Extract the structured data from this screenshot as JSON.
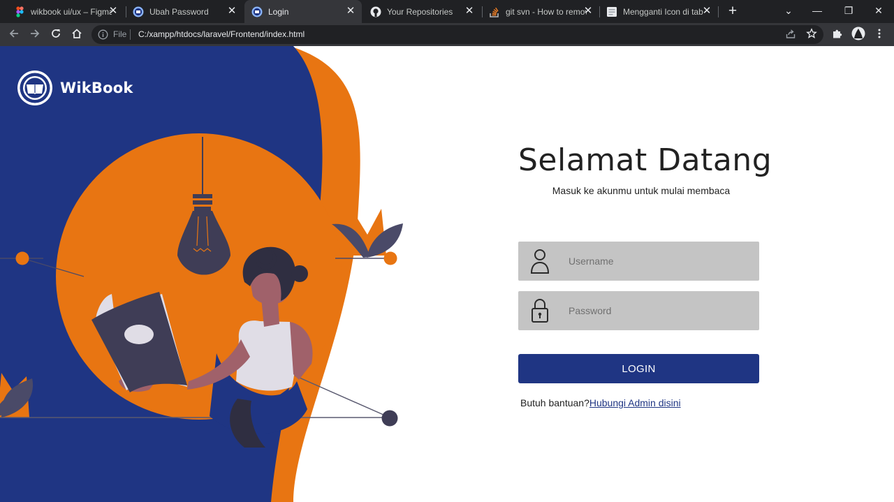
{
  "browser": {
    "tabs": [
      {
        "title": "wikbook ui/ux – Figma",
        "icon": "figma-icon",
        "active": false
      },
      {
        "title": "Ubah Password",
        "icon": "wikbook-favicon-icon",
        "active": false
      },
      {
        "title": "Login",
        "icon": "wikbook-favicon-icon",
        "active": true
      },
      {
        "title": "Your Repositories",
        "icon": "github-icon",
        "active": false
      },
      {
        "title": "git svn - How to remove",
        "icon": "stackoverflow-icon",
        "active": false
      },
      {
        "title": "Mengganti Icon di tab",
        "icon": "page-icon",
        "active": false
      }
    ],
    "tab_close_glyph": "✕",
    "new_tab_glyph": "+",
    "window_controls": {
      "list": "⌄",
      "minimize": "—",
      "restore": "❐",
      "close": "✕"
    },
    "omnibox": {
      "scheme_label": "File",
      "url": "C:/xampp/htdocs/laravel/Frontend/index.html"
    }
  },
  "brand": {
    "name": "WikBook"
  },
  "login": {
    "title": "Selamat Datang",
    "subtitle": "Masuk ke akunmu untuk mulai membaca",
    "username_placeholder": "Username",
    "password_placeholder": "Password",
    "login_button": "LOGIN",
    "help_text": "Butuh bantuan?",
    "help_link": "Hubungi Admin disini"
  },
  "colors": {
    "primary": "#1f3583",
    "orange": "#e87512",
    "field_bg": "#c4c4c4",
    "chrome_dark": "#202124",
    "chrome_toolbar": "#35363a"
  }
}
